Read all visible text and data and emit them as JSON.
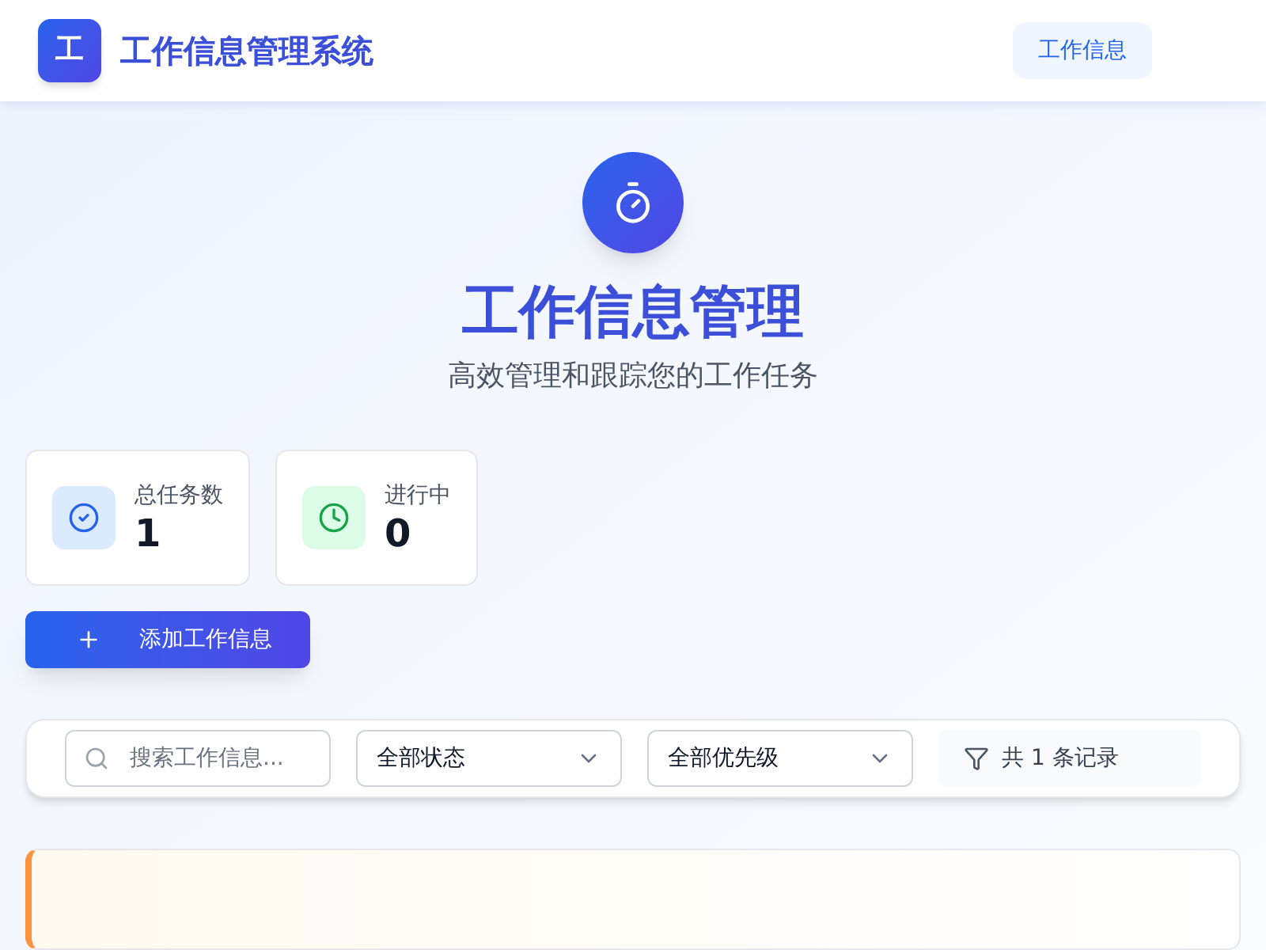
{
  "header": {
    "logo_letter": "工",
    "title": "工作信息管理系统",
    "nav": [
      {
        "label": "工作信息",
        "selected": true
      }
    ]
  },
  "hero": {
    "title": "工作信息管理",
    "subtitle": "高效管理和跟踪您的工作任务"
  },
  "stats": [
    {
      "kind": "total",
      "label": "总任务数",
      "value": "1"
    },
    {
      "kind": "progress",
      "label": "进行中",
      "value": "0"
    }
  ],
  "add_button": "添加工作信息",
  "filters": {
    "search": {
      "placeholder": "搜索工作信息..."
    },
    "status": "全部状态",
    "priority": "全部优先级",
    "count": "共 1 条记录"
  }
}
